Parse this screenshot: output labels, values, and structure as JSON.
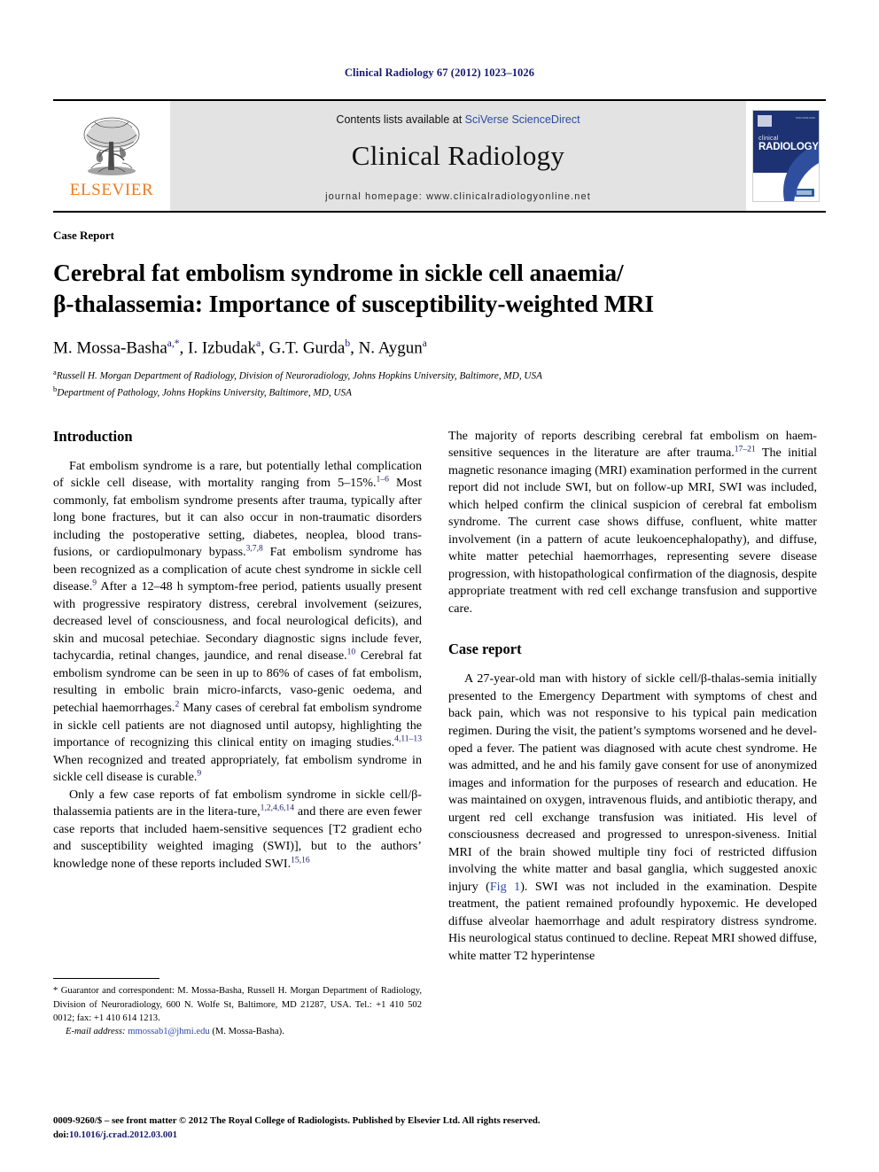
{
  "running_head": "Clinical Radiology 67 (2012) 1023–1026",
  "masthead": {
    "publisher_name": "ELSEVIER",
    "contents_prefix": "Contents lists available at ",
    "contents_link": "SciVerse ScienceDirect",
    "journal_name": "Clinical Radiology",
    "homepage": "journal homepage: www.clinicalradiologyonline.net",
    "cover": {
      "line1": "clinical",
      "line2": "RADIOLOGY",
      "issue": "ISSN 0009-9260"
    }
  },
  "article": {
    "doctype": "Case Report",
    "title_line1": "Cerebral fat embolism syndrome in sickle cell anaemia/",
    "title_line2": "β-thalassemia: Importance of susceptibility-weighted MRI",
    "authors": [
      {
        "name": "M. Mossa-Basha",
        "marks": "a,*"
      },
      {
        "name": "I. Izbudak",
        "marks": "a"
      },
      {
        "name": "G.T. Gurda",
        "marks": "b"
      },
      {
        "name": "N. Aygun",
        "marks": "a"
      }
    ],
    "affiliations": [
      {
        "mark": "a",
        "text": "Russell H. Morgan Department of Radiology, Division of Neuroradiology, Johns Hopkins University, Baltimore, MD, USA"
      },
      {
        "mark": "b",
        "text": "Department of Pathology, Johns Hopkins University, Baltimore, MD, USA"
      }
    ]
  },
  "sections": {
    "introduction_heading": "Introduction",
    "case_report_heading": "Case report"
  },
  "paragraphs": {
    "intro_p1_a": "Fat embolism syndrome is a rare, but potentially lethal complication of sickle cell disease, with mortality ranging from 5–15%.",
    "intro_p1_ref1": "1–6",
    "intro_p1_b": " Most commonly, fat embolism syndrome presents after trauma, typically after long bone fractures, but it can also occur in non-traumatic disorders including the postoperative setting, diabetes, neoplea, blood trans-fusions, or cardiopulmonary bypass.",
    "intro_p1_ref2": "3,7,8",
    "intro_p1_c": " Fat embolism syndrome has been recognized as a complication of acute chest syndrome in sickle cell disease.",
    "intro_p1_ref3": "9",
    "intro_p1_d": " After a 12–48 h symptom-free period, patients usually present with progressive respiratory distress, cerebral involvement (seizures, decreased level of consciousness, and focal neurological deficits), and skin and mucosal petechiae. Secondary diagnostic signs include fever, tachycardia, retinal changes, jaundice, and renal disease.",
    "intro_p1_ref4": "10",
    "intro_p1_e": " Cerebral fat embolism syndrome can be seen in up to 86% of cases of fat embolism, resulting in embolic brain micro-infarcts, vaso-genic oedema, and petechial haemorrhages.",
    "intro_p1_ref5": "2",
    "intro_p1_f": " Many cases of cerebral fat embolism syndrome in sickle cell patients are not diagnosed until autopsy, highlighting the importance of recognizing this clinical entity on imaging studies.",
    "intro_p1_ref6": "4,11–13",
    "intro_p1_g": " When recognized and treated appropriately, fat embolism syndrome in sickle cell disease is curable.",
    "intro_p1_ref7": "9",
    "intro_p2_a": "Only a few case reports of fat embolism syndrome in sickle cell/β-thalassemia patients are in the litera-ture,",
    "intro_p2_ref1": "1,2,4,6,14",
    "intro_p2_b": " and there are even fewer case reports that included haem-sensitive sequences [T2 gradient echo and susceptibility weighted imaging (SWI)], but to the authors’ knowledge none of these reports included SWI.",
    "intro_p2_ref2": "15,16",
    "right_p1_a": "The majority of reports describing cerebral fat embolism on haem-sensitive sequences in the literature are after trauma.",
    "right_p1_ref1": "17–21",
    "right_p1_b": " The initial magnetic resonance imaging (MRI) examination performed in the current report did not include SWI, but on follow-up MRI, SWI was included, which helped confirm the clinical suspicion of cerebral fat embolism syndrome. The current case shows diffuse, confluent, white matter involvement (in a pattern of acute leukoencephalopathy), and diffuse, white matter petechial haemorrhages, representing severe disease progression, with histopathological confirmation of the diagnosis, despite appropriate treatment with red cell exchange transfusion and supportive care.",
    "case_p1_a": "A 27-year-old man with history of sickle cell/β-thalas-semia initially presented to the Emergency Department with symptoms of chest and back pain, which was not responsive to his typical pain medication regimen. During the visit, the patient’s symptoms worsened and he devel-oped a fever. The patient was diagnosed with acute chest syndrome. He was admitted, and he and his family gave consent for use of anonymized images and information for the purposes of research and education. He was maintained on oxygen, intravenous fluids, and antibiotic therapy, and urgent red cell exchange transfusion was initiated. His level of consciousness decreased and progressed to unrespon-siveness. Initial MRI of the brain showed multiple tiny foci of restricted diffusion involving the white matter and basal ganglia, which suggested anoxic injury (",
    "case_p1_figlink": "Fig 1",
    "case_p1_b": "). SWI was not included in the examination. Despite treatment, the patient remained profoundly hypoxemic. He developed diffuse alveolar haemorrhage and adult respiratory distress syndrome. His neurological status continued to decline. Repeat MRI showed diffuse, white matter T2 hyperintense"
  },
  "footnote": {
    "star": "*",
    "correspondence": " Guarantor and correspondent: M. Mossa-Basha, Russell H. Morgan Department of Radiology, Division of Neuroradiology, 600 N. Wolfe St, Baltimore, MD 21287, USA. Tel.: +1 410 502 0012; fax: +1 410 614 1213.",
    "email_label": "E-mail address:",
    "email": "mmossab1@jhmi.edu",
    "email_suffix": " (M. Mossa-Basha)."
  },
  "copyright": {
    "line1": "0009-9260/$ – see front matter © 2012 The Royal College of Radiologists. Published by Elsevier Ltd. All rights reserved.",
    "doi_label": "doi:",
    "doi_value": "10.1016/j.crad.2012.03.001"
  },
  "colors": {
    "running_head": "#1a1a6e",
    "link": "#2a49a5",
    "elsevier_orange": "#ea7b22",
    "banner_grey": "#e3e3e3",
    "cover_navy": "#1d3273"
  }
}
